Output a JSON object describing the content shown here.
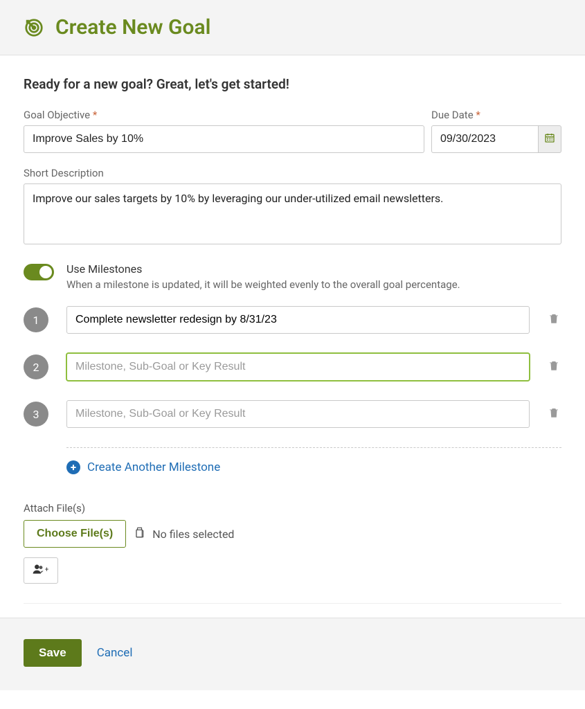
{
  "header": {
    "title": "Create New Goal"
  },
  "intro": "Ready for a new goal? Great, let's get started!",
  "form": {
    "objective_label": "Goal Objective",
    "objective_value": "Improve Sales by 10%",
    "due_date_label": "Due Date",
    "due_date_value": "09/30/2023",
    "description_label": "Short Description",
    "description_value": "Improve our sales targets by 10% by leveraging our under-utilized email newsletters.",
    "required_marker": "*"
  },
  "milestones": {
    "toggle_label": "Use Milestones",
    "toggle_desc": "When a milestone is updated, it will be weighted evenly to the overall goal percentage.",
    "toggle_on": true,
    "placeholder": "Milestone, Sub-Goal or Key Result",
    "items": [
      {
        "num": "1",
        "value": "Complete newsletter redesign by 8/31/23",
        "active": false
      },
      {
        "num": "2",
        "value": "",
        "active": true
      },
      {
        "num": "3",
        "value": "",
        "active": false
      }
    ],
    "add_label": "Create Another Milestone"
  },
  "attach": {
    "label": "Attach File(s)",
    "button": "Choose File(s)",
    "status": "No files selected"
  },
  "footer": {
    "save": "Save",
    "cancel": "Cancel"
  }
}
